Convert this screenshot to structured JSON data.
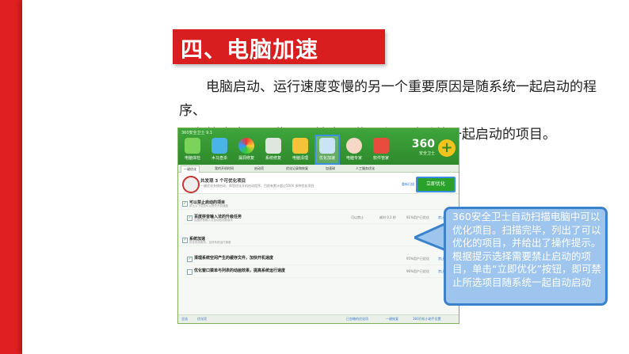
{
  "title": "四、电脑加速",
  "body_lines": [
    "电脑启动、运行速度变慢的另一个重要原因是随系统一起启动的程序、",
    "服务等太多。因此，可禁止一些不必要随系统一起启动的项目。"
  ],
  "callout": "360安全卫士自动扫描电脑中可以优化项目。扫描完毕，列出了可以优化的项目，并给出了操作提示。根据提示选择需要禁止启动的项目，单击“立即优化”按钮，即可禁止所选项目随系统一起自动启动",
  "app": {
    "window_title": "360安全卫士 9.1",
    "tools": [
      "电脑体检",
      "木马查杀",
      "漏洞修复",
      "系统修复",
      "电脑清理",
      "优化加速",
      "电脑专家",
      "软件管家"
    ],
    "logo": "360",
    "logo_sub": "安全卫士",
    "tabs": [
      "一键优化",
      "我的开机时间",
      "启动项",
      "优化记录和恢复",
      "加速球",
      "人工服务优化"
    ],
    "scan_title": "共发现 3 个可优化项目",
    "scan_sub": "一键优化系统启动，帮您优化开机启动程序，目前有累计超过5000 多种优化项目",
    "rescan": "重新扫描",
    "optimize_button": "立即优化",
    "rows": [
      {
        "title": "可以禁止启动的项目",
        "sub": "禁止以下项目可以提升开机速度",
        "c3": "",
        "c4": "",
        "c5": "",
        "c6": "",
        "checked": true
      },
      {
        "title": "百度拼音输入法的升级任务",
        "sub": "百度拼音输入法自动检测新版本",
        "c3": "可以禁止",
        "c4": "耗时 0.1 秒",
        "c5": "91%用户已优化",
        "c6": "禁止启动",
        "checked": true
      },
      {
        "title": "系统加速",
        "sub": "优化系统服务，加快系统运行速度",
        "c3": "",
        "c4": "",
        "c5": "",
        "c6": "",
        "checked": true
      },
      {
        "title": "清理系统空闲产生的缓存文件，加快开机速度",
        "sub": "",
        "c3": "",
        "c4": "",
        "c5": "95%用户已优化",
        "c6": "禁止启动",
        "checked": true
      },
      {
        "title": "优化窗口菜单与列表的动画效果，提高系统运行速度",
        "sub": "",
        "c3": "",
        "c4": "",
        "c5": "96%用户已优化",
        "c6": "禁止启动",
        "checked": false
      }
    ],
    "footer": [
      "全选",
      "优化项",
      "已忽略的优化项",
      "一键恢复",
      "360开机小助手设置"
    ]
  }
}
